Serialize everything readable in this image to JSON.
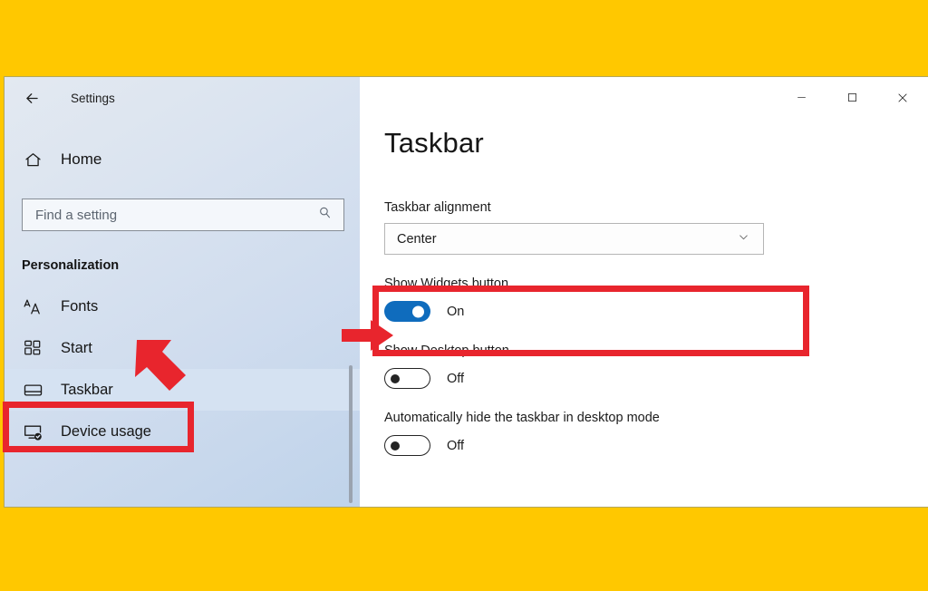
{
  "page": {
    "background_color": "#FFC800",
    "annotation_color": "#e8252d"
  },
  "window": {
    "title": "Settings",
    "back_icon": "back-arrow-icon",
    "controls": {
      "minimize_label": "─",
      "maximize_label": "□",
      "close_label": "✕"
    }
  },
  "sidebar": {
    "home": {
      "label": "Home",
      "icon": "home-icon"
    },
    "search": {
      "value": "",
      "placeholder": "Find a setting",
      "icon": "search-icon"
    },
    "section_title": "Personalization",
    "items": [
      {
        "label": "Fonts",
        "icon": "fonts-aa-icon",
        "selected": false
      },
      {
        "label": "Start",
        "icon": "start-grid-icon",
        "selected": false
      },
      {
        "label": "Taskbar",
        "icon": "taskbar-icon",
        "selected": true
      },
      {
        "label": "Device usage",
        "icon": "device-usage-icon",
        "selected": false
      }
    ]
  },
  "main": {
    "title": "Taskbar",
    "alignment": {
      "label": "Taskbar alignment",
      "value": "Center",
      "chevron_icon": "chevron-down-icon"
    },
    "settings": [
      {
        "label": "Show Widgets button",
        "state": "On",
        "on": true
      },
      {
        "label": "Show Desktop button",
        "state": "Off",
        "on": false
      },
      {
        "label": "Automatically hide the taskbar in desktop mode",
        "state": "Off",
        "on": false
      }
    ]
  },
  "annotations": {
    "highlight_widgets": "red-highlight-box-show-widgets",
    "highlight_taskbar": "red-highlight-box-taskbar",
    "arrow_widgets": "red-arrow-pointing-right-at-widgets-toggle",
    "arrow_taskbar": "red-arrow-pointing-down-right-at-taskbar"
  }
}
